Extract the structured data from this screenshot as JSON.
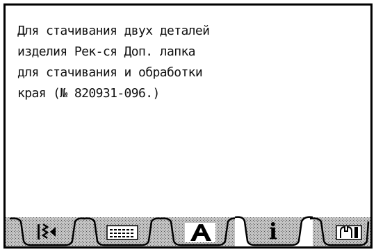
{
  "message": {
    "lines": [
      "Для стачивания двух деталей",
      "изделия Рек-ся Доп. лапка",
      "для стачивания и обработки",
      "края (№ 820931-096.)"
    ]
  },
  "tabs": [
    {
      "id": "stitch-pattern",
      "icon": "zigzag-stitch-icon",
      "active": false
    },
    {
      "id": "stitch-settings",
      "icon": "stitch-grid-icon",
      "active": false
    },
    {
      "id": "alphabet",
      "icon": "letter-a-icon",
      "active": false
    },
    {
      "id": "info",
      "icon": "info-icon",
      "label": "i",
      "active": true
    },
    {
      "id": "setup",
      "icon": "tools-icon",
      "active": false
    }
  ],
  "colors": {
    "frame": "#000000",
    "tab_fill": "#bdbdbd",
    "tab_hatch": "#4a4a4a",
    "active_tab_fill": "#ffffff"
  }
}
